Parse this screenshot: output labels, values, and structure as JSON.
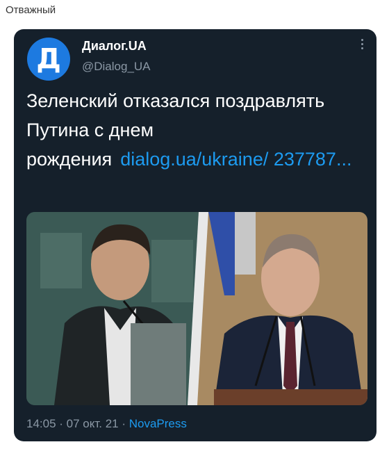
{
  "caption": "Отважный",
  "tweet": {
    "avatar_letter": "Д",
    "display_name": "Диалог.UA",
    "handle": "@Dialog_UA",
    "text": "Зеленский отказался поздравлять Путина с днем рождения",
    "link": "dialog.ua/ukraine/ 237787...",
    "time": "14:05 · 07 окт. 21 · ",
    "source": "NovaPress"
  },
  "colors": {
    "card_bg": "#15202b",
    "link": "#1d9bf0",
    "secondary": "#8b98a5",
    "avatar": "#1d7ae0"
  },
  "icons": [
    "more-options-icon"
  ]
}
